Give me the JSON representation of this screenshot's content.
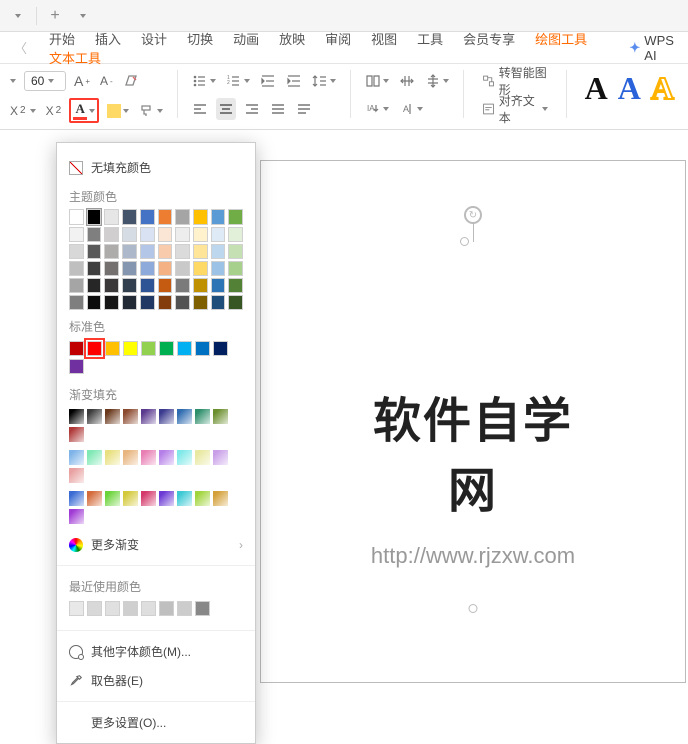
{
  "titlebar": {
    "add": "+"
  },
  "menu": {
    "items": [
      "开始",
      "插入",
      "设计",
      "切换",
      "动画",
      "放映",
      "审阅",
      "视图",
      "工具",
      "会员专享",
      "绘图工具",
      "文本工具"
    ],
    "activeIndexes": [
      10,
      11
    ],
    "ai": "WPS AI"
  },
  "toolbar": {
    "fontsize": "60",
    "smart_shape": "转智能图形",
    "align_text": "对齐文本"
  },
  "text_styles": {
    "a1": "A",
    "a2": "A",
    "a3": "A"
  },
  "dropdown": {
    "no_fill": "无填充颜色",
    "theme_label": "主题颜色",
    "standard_label": "标准色",
    "gradient_label": "渐变填充",
    "more_gradient": "更多渐变",
    "recent_label": "最近使用颜色",
    "other_colors": "其他字体颜色(M)...",
    "eyedropper": "取色器(E)",
    "more_settings": "更多设置(O)...",
    "theme_top": [
      "#ffffff",
      "#000000",
      "#e7e6e6",
      "#44546a",
      "#4472c4",
      "#ed7d31",
      "#a5a5a5",
      "#ffc000",
      "#5b9bd5",
      "#70ad47"
    ],
    "theme_shades": [
      [
        "#f2f2f2",
        "#7f7f7f",
        "#d0cece",
        "#d6dce4",
        "#d9e2f3",
        "#fbe5d5",
        "#ededed",
        "#fff2cc",
        "#deebf6",
        "#e2efd9"
      ],
      [
        "#d8d8d8",
        "#595959",
        "#aeabab",
        "#adb9ca",
        "#b4c6e7",
        "#f7cbac",
        "#dbdbdb",
        "#fee599",
        "#bdd7ee",
        "#c5e0b3"
      ],
      [
        "#bfbfbf",
        "#3f3f3f",
        "#757070",
        "#8496b0",
        "#8eaadb",
        "#f4b183",
        "#c9c9c9",
        "#ffd965",
        "#9cc3e5",
        "#a8d08d"
      ],
      [
        "#a5a5a5",
        "#262626",
        "#3a3838",
        "#323f4f",
        "#2f5496",
        "#c55a11",
        "#7b7b7b",
        "#bf9000",
        "#2e75b5",
        "#538135"
      ],
      [
        "#7f7f7f",
        "#0c0c0c",
        "#171616",
        "#222a35",
        "#1f3864",
        "#833c0b",
        "#525252",
        "#7f6000",
        "#1e4e79",
        "#375623"
      ]
    ],
    "standard": [
      "#c00000",
      "#ff0000",
      "#ffc000",
      "#ffff00",
      "#92d050",
      "#00b050",
      "#00b0f0",
      "#0070c0",
      "#002060",
      "#7030a0"
    ],
    "standard_selected": 1,
    "gradients": [
      [
        "#000000",
        "#3b3b3b",
        "#6b3a1e",
        "#8b4a2e",
        "#5a3a8f",
        "#3a3a8f",
        "#2e6bb0",
        "#2e8f6b",
        "#6b8f2e",
        "#b03a3a"
      ],
      [
        "#7fb4e8",
        "#7fe8b4",
        "#e8e07f",
        "#e8b47f",
        "#e87fb4",
        "#b47fe8",
        "#7fe8e8",
        "#e8e8a0",
        "#c9a0e8",
        "#e8a0a0"
      ],
      [
        "#3a6bd4",
        "#d46b3a",
        "#6bd43a",
        "#d4c93a",
        "#d43a6b",
        "#6b3ad4",
        "#3ac9d4",
        "#a0d43a",
        "#d4a03a",
        "#a03ad4"
      ]
    ],
    "recent": [
      "#e8e8e8",
      "#d8d8d8",
      "#e0e0e0",
      "#cfcfcf",
      "#dedede",
      "#bfbfbf",
      "#cccccc",
      "#888888"
    ]
  },
  "slide": {
    "title": "软件自学网",
    "url": "http://www.rjzxw.com"
  }
}
